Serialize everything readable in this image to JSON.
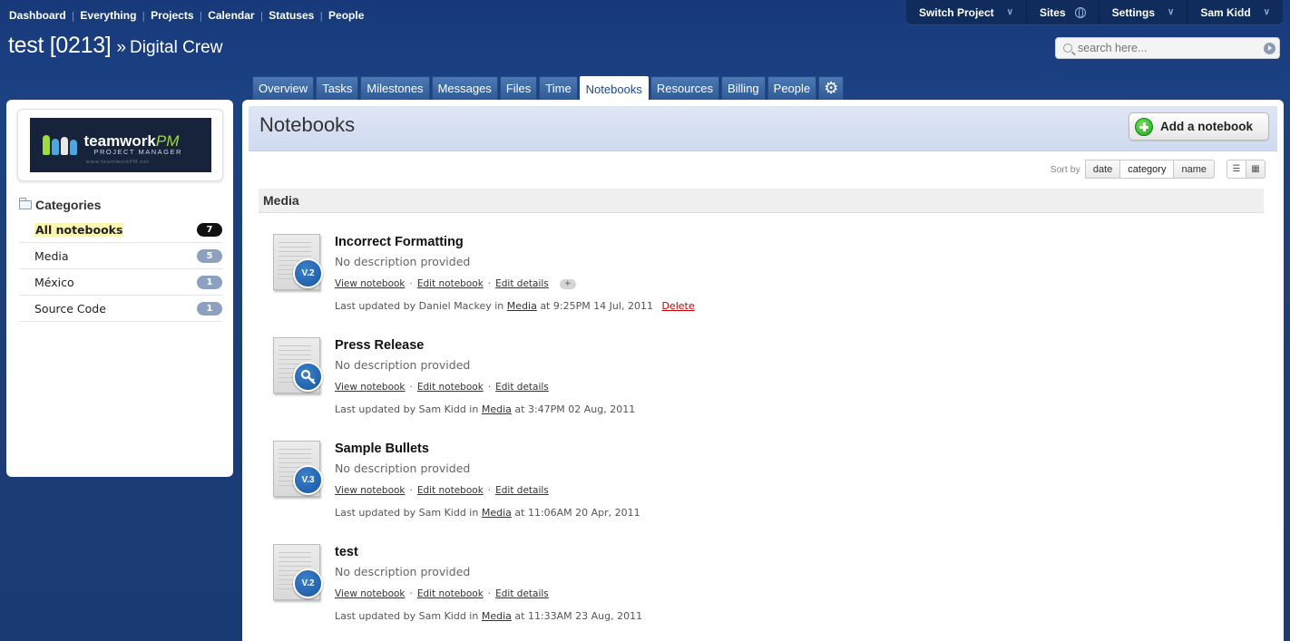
{
  "top_nav": [
    "Dashboard",
    "Everything",
    "Projects",
    "Calendar",
    "Statuses",
    "People"
  ],
  "top_right": {
    "switch_project": "Switch Project",
    "sites": "Sites",
    "settings": "Settings",
    "user": "Sam Kidd"
  },
  "project": {
    "name": "test [0213]",
    "arrow": "»",
    "company": "Digital Crew"
  },
  "search": {
    "placeholder": "search here..."
  },
  "tabs": [
    "Overview",
    "Tasks",
    "Milestones",
    "Messages",
    "Files",
    "Time",
    "Notebooks",
    "Resources",
    "Billing",
    "People"
  ],
  "active_tab": "Notebooks",
  "logo": {
    "brand": "teamwork",
    "brand_accent": "PM",
    "tagline": "PROJECT MANAGER",
    "url": "www.teamworkPM.net"
  },
  "sidebar": {
    "heading": "Categories",
    "categories": [
      {
        "label": "All notebooks",
        "count": "7",
        "selected": true
      },
      {
        "label": "Media",
        "count": "5",
        "selected": false
      },
      {
        "label": "México",
        "count": "1",
        "selected": false
      },
      {
        "label": "Source Code",
        "count": "1",
        "selected": false
      }
    ]
  },
  "main": {
    "title": "Notebooks",
    "add_button": "Add a notebook",
    "sort_label": "Sort by",
    "sort_options": [
      "date",
      "category",
      "name"
    ],
    "active_sort": "category",
    "section": "Media"
  },
  "notebooks": [
    {
      "title": "Incorrect Formatting",
      "description": "No description provided",
      "badge": "V.2",
      "badge_icon": "",
      "links": [
        "View notebook",
        "Edit details"
      ],
      "link_view": "View notebook",
      "link_edit_notebook": "Edit notebook",
      "link_edit_details": "Edit details",
      "has_more": true,
      "updated_prefix": "Last updated by Daniel Mackey in",
      "category": "Media",
      "updated_suffix": "at 9:25PM 14 Jul, 2011",
      "delete": "Delete"
    },
    {
      "title": "Press Release",
      "description": "No description provided",
      "badge": "",
      "badge_icon": "key-icon",
      "link_view": "View notebook",
      "link_edit_notebook": "Edit notebook",
      "link_edit_details": "Edit details",
      "has_more": false,
      "updated_prefix": "Last updated by Sam Kidd in",
      "category": "Media",
      "updated_suffix": "at 3:47PM 02 Aug, 2011",
      "delete": ""
    },
    {
      "title": "Sample Bullets",
      "description": "No description provided",
      "badge": "V.3",
      "badge_icon": "",
      "link_view": "View notebook",
      "link_edit_notebook": "Edit notebook",
      "link_edit_details": "Edit details",
      "has_more": false,
      "updated_prefix": "Last updated by Sam Kidd in",
      "category": "Media",
      "updated_suffix": "at 11:06AM 20 Apr, 2011",
      "delete": ""
    },
    {
      "title": "test",
      "description": "No description provided",
      "badge": "V.2",
      "badge_icon": "",
      "link_view": "View notebook",
      "link_edit_notebook": "Edit notebook",
      "link_edit_details": "Edit details",
      "has_more": false,
      "updated_prefix": "Last updated by Sam Kidd in",
      "category": "Media",
      "updated_suffix": "at 11:33AM 23 Aug, 2011",
      "delete": ""
    }
  ],
  "colors": {
    "page_bg": "#1c4284",
    "tab_bg": "#3d6aa8",
    "header_bg": "#dfe6f5",
    "badge_blue": "#16579f",
    "delete_red": "#cc0000",
    "highlight_yellow": "#fbf7b2"
  }
}
